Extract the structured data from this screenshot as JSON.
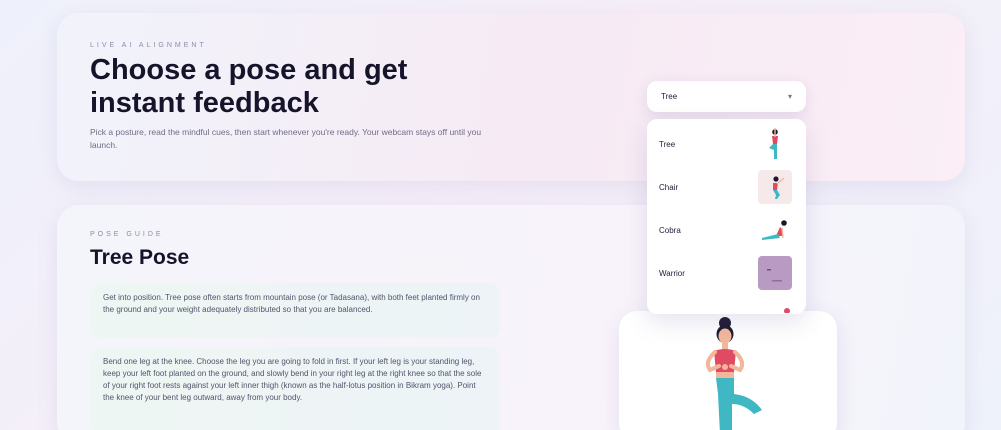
{
  "hero": {
    "eyebrow": "LIVE AI ALIGNMENT",
    "title": "Choose a pose and get instant feedback",
    "subtitle": "Pick a posture, read the mindful cues, then start whenever you're ready. Your webcam stays off until you launch."
  },
  "pose_select": {
    "selected": "Tree",
    "options": [
      {
        "label": "Tree",
        "icon": "tree-pose-icon"
      },
      {
        "label": "Chair",
        "icon": "chair-pose-icon"
      },
      {
        "label": "Cobra",
        "icon": "cobra-pose-icon"
      },
      {
        "label": "Warrior",
        "icon": "warrior-pose-icon"
      }
    ]
  },
  "guide": {
    "eyebrow": "POSE GUIDE",
    "title": "Tree Pose",
    "steps": [
      "Get into position. Tree pose often starts from mountain pose (or Tadasana), with both feet planted firmly on the ground and your weight adequately distributed so that you are balanced.",
      "Bend one leg at the knee. Choose the leg you are going to fold in first. If your left leg is your standing leg, keep your left foot planted on the ground, and slowly bend in your right leg at the right knee so that the sole of your right foot rests against your left inner thigh (known as the half-lotus position in Bikram yoga). Point the knee of your bent leg outward, away from your body."
    ]
  },
  "colors": {
    "title": "#16142b",
    "body_text": "#55536c",
    "figure_top": "#e04b63",
    "figure_legs": "#3fb8c4",
    "skin": "#f2b79b",
    "hair": "#1c1830"
  }
}
